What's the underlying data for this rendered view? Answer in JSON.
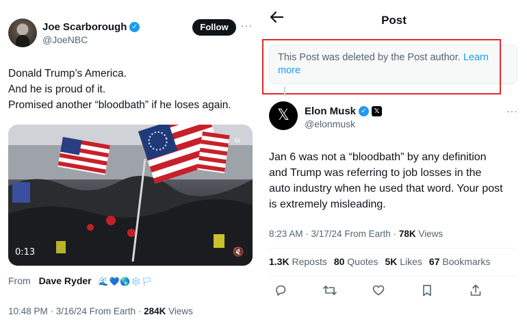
{
  "left_tweet": {
    "author_name": "Joe Scarborough",
    "handle": "@JoeNBC",
    "follow_label": "Follow",
    "more_label": "···",
    "text_lines": [
      "Donald Trump’s America.",
      "And he is proud of it.",
      "Promised another “bloodbath” if he loses again."
    ],
    "video_duration": "0:13",
    "from_label": "From",
    "from_name": "Dave Ryder",
    "from_emojis": "🌊💙🌎❄️🏳",
    "timestamp": "10:48 PM · 3/16/24 From Earth · ",
    "views_count": "284K",
    "views_label": " Views"
  },
  "right_post": {
    "back_icon": "arrow-left-icon",
    "title": "Post",
    "deleted_notice": "This Post was deleted by the Post author. ",
    "learn_more": "Learn more",
    "author_name": "Elon Musk",
    "handle": "@elonmusk",
    "more_label": "···",
    "text_lines": [
      "Jan 6 was not a “bloodbath” by any definition",
      "and Trump was referring to job losses in the",
      "auto industry when he used that word. Your post",
      "is extremely misleading."
    ],
    "timestamp": "8:23 AM · 3/17/24 From Earth · ",
    "views_count": "78K",
    "views_label": " Views",
    "stats": {
      "reposts_count": "1.3K",
      "reposts_label": "Reposts",
      "quotes_count": "80",
      "quotes_label": "Quotes",
      "likes_count": "5K",
      "likes_label": "Likes",
      "bookmarks_count": "67",
      "bookmarks_label": "Bookmarks"
    }
  },
  "colors": {
    "accent": "#1d9bf0",
    "highlight_outline": "#e0282e",
    "muted_text": "#536471"
  }
}
